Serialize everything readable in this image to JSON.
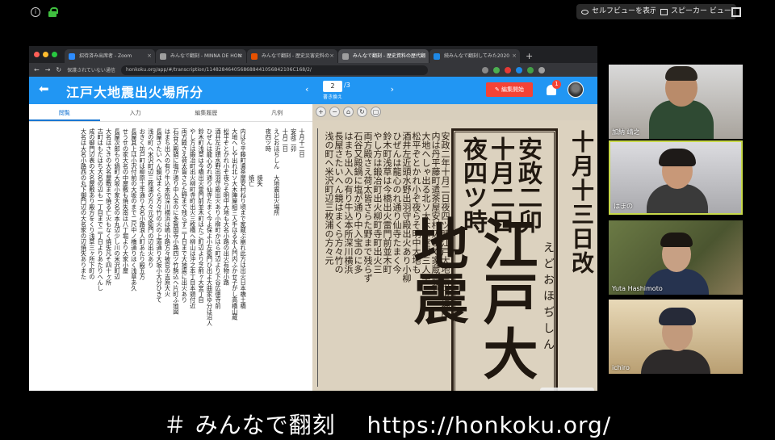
{
  "zoom": {
    "self_view_label": "セルフビューを表示",
    "speaker_view_label": "スピーカー ビュー"
  },
  "browser": {
    "tabs": [
      {
        "label": "招待済み出席者 - Zoom",
        "favicon_color": "#2d8cff",
        "active": false
      },
      {
        "label": "みんなで翻刻 - MINNA DE HON",
        "favicon_color": "#9e9e9e",
        "active": false
      },
      {
        "label": "みんなで翻刻 - 歴史災害史料の",
        "favicon_color": "#e65100",
        "active": false
      },
      {
        "label": "みんなで翻刻 - 歴史資料の歴代翻",
        "favicon_color": "#9e9e9e",
        "active": true
      },
      {
        "label": "続みんなで翻刻してみた2020",
        "favicon_color": "#1e88e5",
        "active": false
      }
    ],
    "new_tab": "+",
    "security_label": "保護されていない通信",
    "url": "honkoku.org/app/#/transcription/1148284640568688441056842106C168/2/"
  },
  "app": {
    "title": "江戸大地震出火場所分",
    "page_current": "2",
    "page_total": "/3",
    "page_sub": "書き換え",
    "edit_button": "編集開始",
    "notification_count": "1",
    "panel_tabs": [
      "閲覧",
      "入力",
      "編集履歴",
      "凡例"
    ]
  },
  "transcription": "十月十二日\n安政二卯\n十月二日\nえどおほぢしん　大地震出火場所\n夜四ツ時\n　　　　　　　　焼失\n　　　　　　　　焼亡\n内はち平藤町遣茶屋安村ねり頃まで家蔵ぶ崩れ此方は出火日本橋土橋\n大地へしや出れ北ソ大木陣屋組三人手はる水人門内ふかせ子がし高橋山蔵\n松平ぞとかれ小ぞ夜らそ明中大地も大名小路の出火有物小路\n酒井左近頭水野出羽守殿出火あり小柳町かはら町辺より下谷広徳寺前\nひぜんは龍心のれ通り仙寺たまく今よ保よ小左衛門ひ出よ大曲家ゆ分は沼人\n鈴木町浅草は今橋出火雷門前並木町はたご町辺より芝前ヶ大宮丁目\nやし方は鍛冶町出火柳町寺町出火三枚橋へ柳山は沖之本丁目本頭付近\n両方殿さえ荷太皆さらた野まで残らず二丁日まで大地震に出火あり\n石谷又殿鍋に塩が通り中入宝のに多賀国寺小路四ツ竹駒込ヘ片町ふ地図\nはまち出入の有り牛込本所深川横浜は嶋小路方々被官の吉原大火\n長屋さたいへん鏡はまくら方々竹の火の上道通り大坂小大分ひきて\n浅の町へ米沢町辺三枚浦の方々元文衛門の辺出火あり\nおきく坊戸町は柳原土手通り大名小路浪人町あたり殿五方\n長屋其上は小沢付前の大坂のまで二尺中ノ橋通りほく浅草あ久\nせうせの家大名の中屋敷も焼失南は八丁堀より大家小屋\n長屋次郎もり鍋町大坂小家大名の本丸辺少し川の米沢町辺\n大名はさきの大名屋敷まで焼る亡火もなく焼失凡そ四十ヶ所\n古町はもたはち大名の辺も一丁目まで二丁日よりあたりへんし\n成の御門辺表の大名屋敷あり殿方をくり浅草三ヶ所下町の\n大名は大名小路西の丸下御門辺の大名家の辺焼失ありまた",
  "document": {
    "date_heading": "十月十三日改",
    "title_era": "安政二卯",
    "title_date": "十月二日",
    "title_time": "夜四ツ時",
    "title_main": "江戸大地震",
    "furigana": "えどおほぢしん",
    "columns": [
      "安政二年十月二日夜四ツ時江戸大地震出火場所",
      "内は丹平藤町遣茶屋安村辺まで家蔵崩れ",
      "大地へしゃ出る北ソ大木陣屋組三人手",
      "松平ぞとかれ小ぞ夜らそ明中大地も",
      "酒井左近頭水野出羽守殿出火あり小柳",
      "ひぜんは龍心のれ通り仙寺たまく今",
      "鈴木町浅草は今橋出火雷門前並木町",
      "やし方は鍛冶町出火柳町寺町出火三",
      "両方殿さえ荷太皆さらた野まで残らず",
      "石谷又殿鍋に塩が通り中入宝のに多",
      "はまち出入の有り牛込本所深川横浜",
      "長屋さたいへん鏡はまくら方々竹の",
      "浅の町へ米沢町辺三枚浦の方々元"
    ]
  },
  "participants": [
    {
      "name": "加納 靖之",
      "bg": "#8a8580"
    },
    {
      "name": "はまの",
      "bg": "#b8b8bc"
    },
    {
      "name": "Yuta Hashimoto",
      "bg": "#5d6b3c"
    },
    {
      "name": "ichiro",
      "bg": "#c9b48e"
    }
  ],
  "caption": "＃ みんなで翻刻　 https://honkoku.org/"
}
